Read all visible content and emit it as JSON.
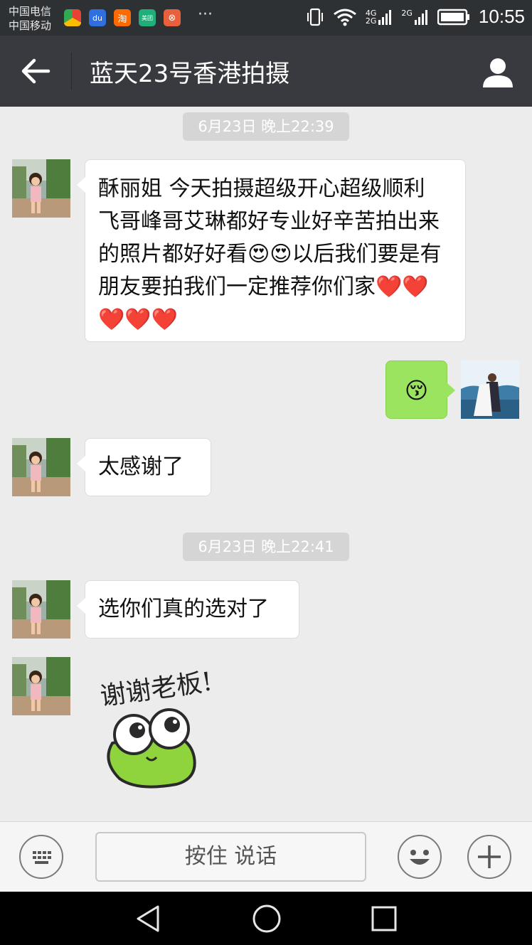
{
  "status_bar": {
    "carrier_1": "中国电信",
    "carrier_2": "中国移动",
    "more_label": "···",
    "network_top": "4G",
    "network_bottom": "2G",
    "network_2": "2G",
    "time": "10:55",
    "app_icons": [
      {
        "name": "chrome-app-icon",
        "label": "",
        "color": "#e8b33a"
      },
      {
        "name": "baidu-app-icon",
        "label": "du",
        "color": "#3a6fd8"
      },
      {
        "name": "taobao-app-icon",
        "label": "淘",
        "color": "#ff6a00"
      },
      {
        "name": "meituan-app-icon",
        "label": "美团",
        "color": "#20b478"
      },
      {
        "name": "settings-app-icon",
        "label": "⊗",
        "color": "#e8603c"
      }
    ]
  },
  "header": {
    "back_icon": "arrow-left-icon",
    "title": "蓝天23号香港拍摄",
    "profile_icon": "person-icon"
  },
  "messages": {
    "timestamp_1": "6月23日 晚上22:39",
    "msg_1_text": "酥丽姐 今天拍摄超级开心超级顺利 飞哥峰哥艾琳都好专业好辛苦拍出来的照片都好好看😍😍以后我们要是有朋友要拍我们一定推荐你们家❤️❤️❤️❤️❤️",
    "msg_2_emoji": "😚",
    "msg_3_text": "太感谢了",
    "timestamp_2": "6月23日 晚上22:41",
    "msg_4_text": "选你们真的选对了",
    "sticker_text": "谢谢老板!"
  },
  "input_bar": {
    "keyboard_icon": "keyboard-icon",
    "voice_label": "按住 说话",
    "emoji_icon": "smiley-icon",
    "plus_icon": "plus-icon"
  },
  "colors": {
    "header_bg": "#393a3f",
    "chat_bg": "#ececec",
    "sent_bubble": "#9ae45f",
    "received_bubble": "#ffffff"
  }
}
